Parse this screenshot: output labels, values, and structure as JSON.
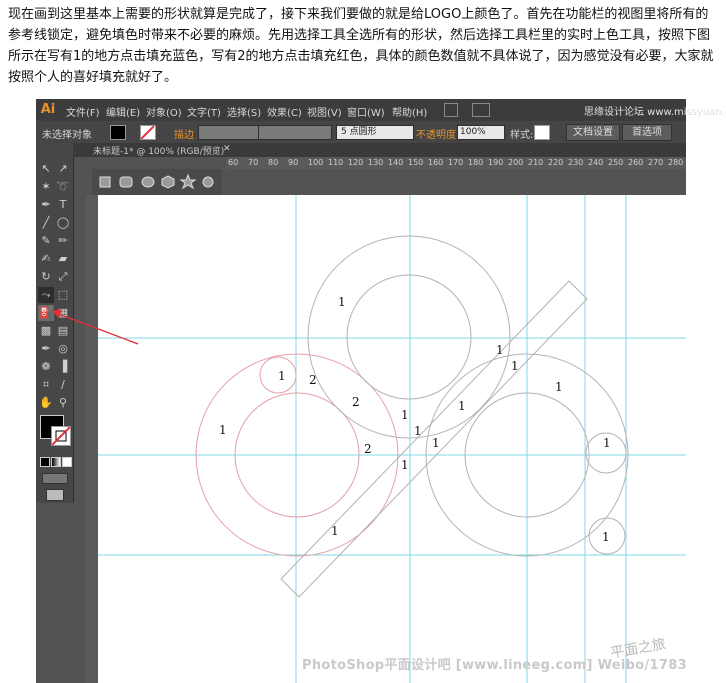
{
  "intro_text": "现在画到这里基本上需要的形状就算是完成了，接下来我们要做的就是给LOGO上颜色了。首先在功能栏的视图里将所有的参考线锁定，避免填色时带来不必要的麻烦。先用选择工具全选所有的形状，然后选择工具栏里的实时上色工具，按照下图所示在写有1的地方点击填充蓝色，写有2的地方点击填充红色，具体的颜色数值就不具体说了，因为感觉没有必要，大家就按照个人的喜好填充就好了。",
  "app": {
    "logo": "Ai",
    "menu": [
      "文件(F)",
      "编辑(E)",
      "对象(O)",
      "文字(T)",
      "选择(S)",
      "效果(C)",
      "视图(V)",
      "窗口(W)",
      "帮助(H)"
    ],
    "brand": "思缘设计论坛 www.missyuan.com"
  },
  "control_bar": {
    "selection": "未选择对象",
    "stroke_label": "描边",
    "brush": "5 点圆形",
    "opacity_label": "不透明度",
    "opacity_value": "100%",
    "style_label": "样式:",
    "doc_setup": "文档设置",
    "prefs": "首选项"
  },
  "document_tab": "未标题-1* @ 100% (RGB/预览)",
  "ruler_ticks": [
    "60",
    "70",
    "80",
    "90",
    "100",
    "110",
    "120",
    "130",
    "140",
    "150",
    "160",
    "170",
    "180",
    "190",
    "200",
    "210",
    "220",
    "230",
    "240",
    "250",
    "260",
    "270",
    "280"
  ],
  "canvas_labels": [
    {
      "text": "1"
    },
    {
      "text": "1"
    },
    {
      "text": "2"
    },
    {
      "text": "2"
    },
    {
      "text": "1"
    },
    {
      "text": "1"
    },
    {
      "text": "1"
    },
    {
      "text": "1"
    },
    {
      "text": "1"
    },
    {
      "text": "1"
    },
    {
      "text": "2"
    },
    {
      "text": "1"
    },
    {
      "text": "1"
    },
    {
      "text": "1"
    },
    {
      "text": "1"
    },
    {
      "text": "1"
    },
    {
      "text": "1"
    }
  ],
  "colors": {
    "guide": "#7fd8e6",
    "red_path": "#e5a0a8",
    "gray_path": "#b3b3b3",
    "accent": "#e8932b",
    "arrow": "#e0303a"
  },
  "watermark": "PhotoShop平面设计吧 [www.lineeg.com] Weibo/1783",
  "watermark2": "平面之旅"
}
